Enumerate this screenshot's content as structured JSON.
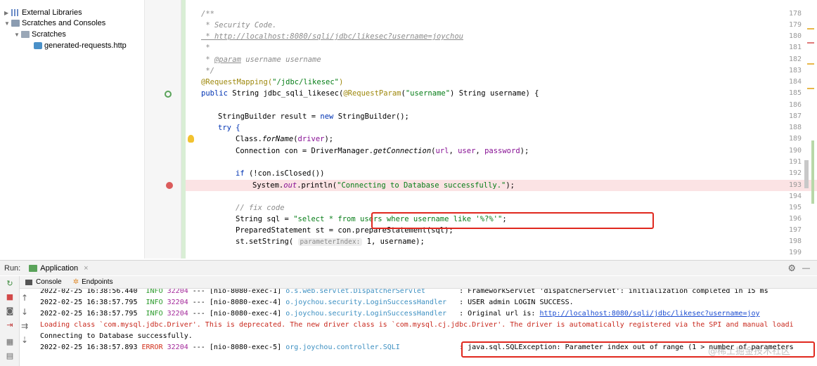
{
  "tree": {
    "external_libraries": "External Libraries",
    "scratches_and_consoles": "Scratches and Consoles",
    "scratches": "Scratches",
    "generated_requests": "generated-requests.http"
  },
  "editor": {
    "lines": [
      {
        "n": "178",
        "t": "/**"
      },
      {
        "n": "179",
        "t": " * Security Code."
      },
      {
        "n": "180",
        "t": " * http://localhost:8080/sqli/jdbc/likesec?username=joychou"
      },
      {
        "n": "181",
        "t": " *"
      },
      {
        "n": "182",
        "t": " * @param username username"
      },
      {
        "n": "183",
        "t": " */"
      },
      {
        "n": "184",
        "t": "@RequestMapping(\"/jdbc/likesec\")"
      },
      {
        "n": "185",
        "t": "public String jdbc_sqli_likesec(@RequestParam(\"username\") String username) {"
      },
      {
        "n": "186",
        "t": ""
      },
      {
        "n": "187",
        "t": "StringBuilder result = new StringBuilder();"
      },
      {
        "n": "188",
        "t": "try {"
      },
      {
        "n": "189",
        "t": "Class.forName(driver);"
      },
      {
        "n": "190",
        "t": "Connection con = DriverManager.getConnection(url, user, password);"
      },
      {
        "n": "191",
        "t": ""
      },
      {
        "n": "192",
        "t": "if (!con.isClosed())"
      },
      {
        "n": "193",
        "t": "System.out.println(\"Connecting to Database successfully.\");"
      },
      {
        "n": "194",
        "t": ""
      },
      {
        "n": "195",
        "t": "// fix code"
      },
      {
        "n": "196",
        "t": "String sql = \"select * from users where username like '%?%'\";"
      },
      {
        "n": "197",
        "t": "PreparedStatement st = con.prepareStatement(sql);"
      },
      {
        "n": "198",
        "t": "st.setString( parameterIndex: 1, username);"
      },
      {
        "n": "199",
        "t": ""
      }
    ],
    "hint": "parameterIndex:"
  },
  "run": {
    "label": "Run:",
    "config": "Application",
    "close": "×",
    "tab_console": "Console",
    "tab_endpoints": "Endpoints"
  },
  "console": {
    "lines": [
      "2022-02-25 16:38:56.440  INFO 32204 --- [nio-8080-exec-1] o.s.web.servlet.DispatcherServlet        : FrameworkServlet 'dispatcherServlet': initialization completed in 15 ms",
      "2022-02-25 16:38:57.795  INFO 32204 --- [nio-8080-exec-4] o.joychou.security.LoginSuccessHandler   : USER admin LOGIN SUCCESS.",
      "2022-02-25 16:38:57.795  INFO 32204 --- [nio-8080-exec-4] o.joychou.security.LoginSuccessHandler   : Original url is: http://localhost:8080/sqli/jdbc/likesec?username=joy",
      "Loading class `com.mysql.jdbc.Driver'. This is deprecated. The new driver class is `com.mysql.cj.jdbc.Driver'. The driver is automatically registered via the SPI and manual loadi",
      "Connecting to Database successfully.",
      "2022-02-25 16:38:57.893 ERROR 32204 --- [nio-8080-exec-5] org.joychou.controller.SQLI              : java.sql.SQLException: Parameter index out of range (1 > number of parameters"
    ],
    "watermark": "@稀土掘金技术社区"
  }
}
